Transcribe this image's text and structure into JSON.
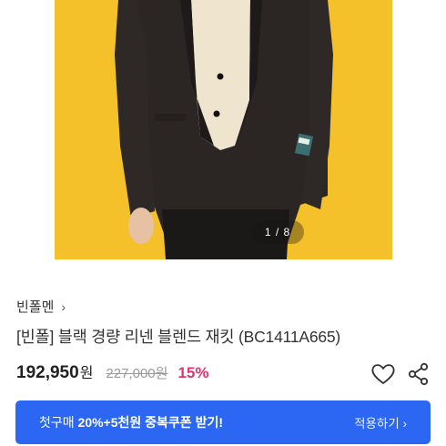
{
  "gallery": {
    "counter": "1 / 8"
  },
  "brand": {
    "name": "빈폴멘",
    "chevron": "›"
  },
  "product": {
    "title": "[빈폴] 블랙 경량 리넨 블렌드 재킷 (BC1411A665)",
    "price": "192,950",
    "price_unit": "원",
    "original_price": "227,000원",
    "discount": "15%"
  },
  "icons": {
    "wishlist": "heart-icon",
    "share": "share-icon"
  },
  "coupon": {
    "prefix": "첫구매 ",
    "highlight": "20%+5천원",
    "suffix": " 중복쿠폰 받기!",
    "action": "적용하기 ›"
  },
  "colors": {
    "coupon_bg": "#2b67f2",
    "discount": "#e23370",
    "hero_bg": "#f4c12a"
  }
}
